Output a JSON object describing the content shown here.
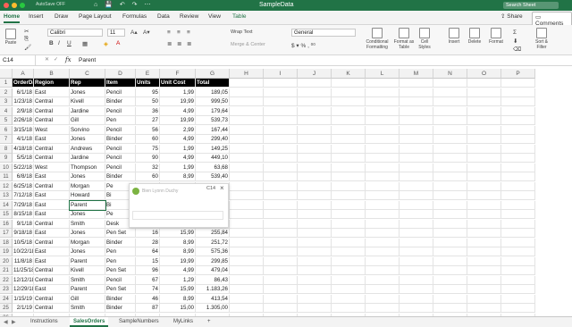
{
  "window": {
    "autosave": "AutoSave  OFF",
    "quick_access": "⌂ 💾 ↶ ↷ ⋯",
    "title": "SampleData",
    "search_placeholder": "Search Sheet"
  },
  "ribbon_tabs": [
    "Home",
    "Insert",
    "Draw",
    "Page Layout",
    "Formulas",
    "Data",
    "Review",
    "View",
    "Table"
  ],
  "share_label": "Share",
  "comments_label": "Comments",
  "ribbon": {
    "paste": "Paste",
    "font_name": "Calibri",
    "font_size": "11",
    "wrap_text": "Wrap Text",
    "merge_center": "Merge & Center",
    "number_format": "General",
    "conditional_formatting": "Conditional Formatting",
    "format_as_table": "Format as Table",
    "cell_styles": "Cell Styles",
    "insert": "Insert",
    "delete": "Delete",
    "format": "Format",
    "sort_filter": "Sort & Filter",
    "bold": "B",
    "italic": "I",
    "underline": "U"
  },
  "formula_bar": {
    "name_box": "C14",
    "fx": "fx",
    "value": "Parent"
  },
  "columns": [
    "A",
    "B",
    "C",
    "D",
    "E",
    "F",
    "G",
    "H",
    "I",
    "J",
    "K",
    "L",
    "M",
    "N",
    "O",
    "P"
  ],
  "table": {
    "headers": [
      "OrderDate",
      "Region",
      "Rep",
      "Item",
      "Units",
      "Unit Cost",
      "Total"
    ],
    "rows": [
      [
        "6/1/18",
        "East",
        "Jones",
        "Pencil",
        "95",
        "1,99",
        "189,05"
      ],
      [
        "1/23/18",
        "Central",
        "Kivell",
        "Binder",
        "50",
        "19,99",
        "999,50"
      ],
      [
        "2/9/18",
        "Central",
        "Jardine",
        "Pencil",
        "36",
        "4,99",
        "179,64"
      ],
      [
        "2/26/18",
        "Central",
        "Gill",
        "Pen",
        "27",
        "19,99",
        "539,73"
      ],
      [
        "3/15/18",
        "West",
        "Sorvino",
        "Pencil",
        "56",
        "2,99",
        "167,44"
      ],
      [
        "4/1/18",
        "East",
        "Jones",
        "Binder",
        "60",
        "4,99",
        "299,40"
      ],
      [
        "4/18/18",
        "Central",
        "Andrews",
        "Pencil",
        "75",
        "1,99",
        "149,25"
      ],
      [
        "5/5/18",
        "Central",
        "Jardine",
        "Pencil",
        "90",
        "4,99",
        "449,10"
      ],
      [
        "5/22/18",
        "West",
        "Thompson",
        "Pencil",
        "32",
        "1,99",
        "63,68"
      ],
      [
        "6/8/18",
        "East",
        "Jones",
        "Binder",
        "60",
        "8,99",
        "539,40"
      ],
      [
        "6/25/18",
        "Central",
        "Morgan",
        "Pe",
        "",
        "",
        "449,10"
      ],
      [
        "7/12/18",
        "East",
        "Howard",
        "Bi",
        "",
        "",
        "57,71"
      ],
      [
        "7/29/18",
        "East",
        "Parent",
        "Bi",
        "",
        "",
        "519,19"
      ],
      [
        "8/15/18",
        "East",
        "Jones",
        "Pe",
        "",
        "",
        "174,65"
      ],
      [
        "9/1/18",
        "Central",
        "Smith",
        "Desk",
        "2",
        "125,00",
        "250,00"
      ],
      [
        "9/18/18",
        "East",
        "Jones",
        "Pen Set",
        "16",
        "15,99",
        "255,84"
      ],
      [
        "10/5/18",
        "Central",
        "Morgan",
        "Binder",
        "28",
        "8,99",
        "251,72"
      ],
      [
        "10/22/18",
        "East",
        "Jones",
        "Pen",
        "64",
        "8,99",
        "575,36"
      ],
      [
        "11/8/18",
        "East",
        "Parent",
        "Pen",
        "15",
        "19,99",
        "299,85"
      ],
      [
        "11/25/18",
        "Central",
        "Kivell",
        "Pen Set",
        "96",
        "4,99",
        "479,04"
      ],
      [
        "12/12/18",
        "Central",
        "Smith",
        "Pencil",
        "67",
        "1,29",
        "86,43"
      ],
      [
        "12/29/18",
        "East",
        "Parent",
        "Pen Set",
        "74",
        "15,99",
        "1.183,26"
      ],
      [
        "1/15/19",
        "Central",
        "Gill",
        "Binder",
        "46",
        "8,99",
        "413,54"
      ],
      [
        "2/1/19",
        "Central",
        "Smith",
        "Binder",
        "87",
        "15,00",
        "1.305,00"
      ]
    ]
  },
  "row_numbers": [
    "1",
    "2",
    "3",
    "4",
    "5",
    "6",
    "7",
    "8",
    "9",
    "10",
    "11",
    "12",
    "13",
    "14",
    "15",
    "16",
    "17",
    "18",
    "19",
    "20",
    "21",
    "22",
    "23",
    "24",
    "25",
    "26"
  ],
  "comment_popup": {
    "author": "Bien Lyonn Duchy",
    "cell_ref": "C14",
    "close": "×"
  },
  "sheet_tabs": [
    "Instructions",
    "SalesOrders",
    "SampleNumbers",
    "MyLinks"
  ],
  "add_sheet": "+",
  "accent_color": "#217346"
}
